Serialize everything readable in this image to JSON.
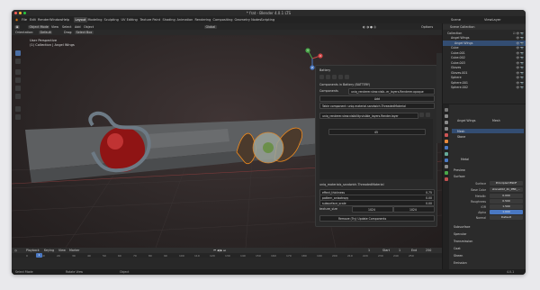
{
  "window": {
    "title": "* frat - Blender 4.0.1 LTS",
    "traffic_lights": [
      "#ff5f57",
      "#febc2e",
      "#28c840"
    ]
  },
  "menubar": {
    "items": [
      "File",
      "Edit",
      "Render",
      "Window",
      "Help"
    ],
    "workspaces": [
      "Layout",
      "Modeling",
      "Sculpting",
      "UV Editing",
      "Texture Paint",
      "Shading",
      "Animation",
      "Rendering",
      "Compositing",
      "Geometry Nodes",
      "Scripting"
    ],
    "active_workspace": "Layout",
    "scene_label": "Scene",
    "view_layer_label": "ViewLayer"
  },
  "tool_header": {
    "mode": "Object Mode",
    "items": [
      "View",
      "Select",
      "Add",
      "Object"
    ],
    "transform": "Global",
    "options_label": "Options"
  },
  "view_header": {
    "orientation_label": "Orientation:",
    "orientation_value": "Default",
    "drag_label": "Drag:",
    "drag_value": "Select Box"
  },
  "viewport": {
    "perspective": "User Perspective",
    "collection": "(1) Collection | Angel Wings",
    "gizmo_axes": [
      "X",
      "Y",
      "Z"
    ]
  },
  "side_panel": {
    "title": "Battery",
    "section": "Components in Battery (BATTERY)",
    "components_label": "Components",
    "components_value": "uniq_renderer.view.visib..er_layers.Renderer.opaque",
    "add_label": "Add",
    "table_text": "Table component: uniq.material.sandwich.ThreadedMaterial",
    "row_text": "uniq_renderer.view.visibility.visible_layers.Render.layer",
    "value_field": "45",
    "mat_header": "uniq_materials_sandwich.ThreadedMaterial",
    "mat_rows": [
      {
        "label": "effect_thickness",
        "value": "0.75"
      },
      {
        "label": "pattern_anisotropy",
        "value": "0.00"
      },
      {
        "label": "subsurface_scale",
        "value": "0.00"
      }
    ],
    "texture_size_label": "texture_size",
    "texture_size_x": "1024",
    "texture_size_y": "1024",
    "remove_label": "Remove (Try) Update Components"
  },
  "timeline": {
    "header_items": [
      "Playback",
      "Keying",
      "View",
      "Marker"
    ],
    "current_frame": "1",
    "ruler": [
      "0",
      "10",
      "20",
      "30",
      "40",
      "50",
      "60",
      "70",
      "80",
      "90",
      "100",
      "110",
      "120",
      "130",
      "140",
      "150",
      "160",
      "170",
      "180",
      "190",
      "200",
      "210",
      "220",
      "230",
      "240",
      "250"
    ],
    "start_label": "Start",
    "start_value": "1",
    "end_label": "End",
    "end_value": "250"
  },
  "statusbar": {
    "left": "Select Mode",
    "mid": "Rotate View",
    "right": "Object",
    "version": "4.0.1"
  },
  "outliner": {
    "title": "Scene Collection",
    "rows": [
      {
        "label": "Collection",
        "indent": 0
      },
      {
        "label": "Angel Wings",
        "indent": 1
      },
      {
        "label": "Angel Wings",
        "indent": 2
      },
      {
        "label": "Cube",
        "indent": 1
      },
      {
        "label": "Cube.001",
        "indent": 1
      },
      {
        "label": "Cube.002",
        "indent": 1
      },
      {
        "label": "Cube.003",
        "indent": 1
      },
      {
        "label": "Gloves",
        "indent": 1
      },
      {
        "label": "Gloves.001",
        "indent": 1
      },
      {
        "label": "Sphere",
        "indent": 1
      },
      {
        "label": "Sphere.001",
        "indent": 1
      },
      {
        "label": "Sphere.002",
        "indent": 1
      }
    ]
  },
  "properties": {
    "object_name": "Angel Wings",
    "data_name": "Mesh",
    "slots": [
      "Mesh",
      "Stone"
    ],
    "material_name": "Metal",
    "preview_label": "Preview",
    "surface_label": "Surface",
    "surface_type_label": "Surface",
    "surface_type_value": "Principled BSDF",
    "base_color_label": "Base Color",
    "base_color_value": "stone002_2k_PBR_...",
    "props": [
      {
        "label": "Metallic",
        "value": "0.000"
      },
      {
        "label": "Roughness",
        "value": "0.500"
      },
      {
        "label": "IOR",
        "value": "1.500"
      },
      {
        "label": "Alpha",
        "value": "1.000"
      }
    ],
    "normal_label": "Normal",
    "normal_value": "Default",
    "sections": [
      "Subsurface",
      "Specular",
      "Transmission",
      "Coat",
      "Sheen",
      "Emission"
    ]
  }
}
